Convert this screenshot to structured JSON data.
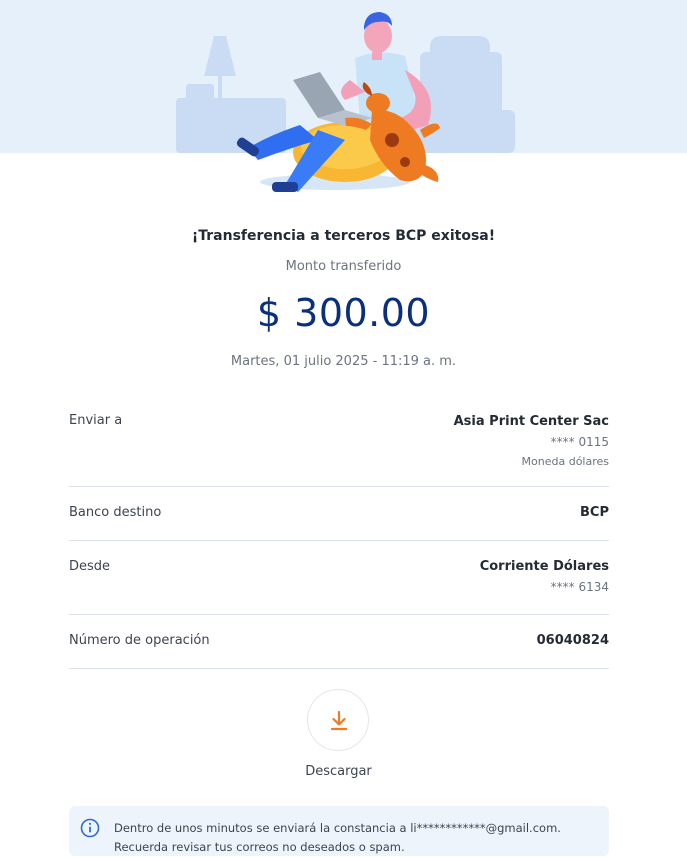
{
  "hero": {
    "illustration": "person-with-laptop-and-dog"
  },
  "colors": {
    "accent_orange": "#ee7a22",
    "primary_blue": "#0b2f7f",
    "hero_bg": "#e6f0fb"
  },
  "header": {
    "title": "¡Transferencia a terceros BCP exitosa!",
    "subtitle": "Monto transferido",
    "amount": "$ 300.00",
    "date": "Martes, 01 julio 2025 - 11:19 a. m."
  },
  "details": {
    "recipient": {
      "label": "Enviar a",
      "name": "Asia Print Center Sac",
      "account": "**** 0115",
      "currency": "Moneda dólares"
    },
    "bank": {
      "label": "Banco destino",
      "value": "BCP"
    },
    "origin": {
      "label": "Desde",
      "account_type": "Corriente Dólares",
      "account": "**** 6134"
    },
    "operation": {
      "label": "Número de operación",
      "value": "06040824"
    }
  },
  "download": {
    "icon": "download-icon",
    "label": "Descargar"
  },
  "notice": {
    "icon": "info-icon",
    "text": "Dentro de unos minutos se enviará la constancia a li************@gmail.com. Recuerda revisar tus correos no deseados o spam."
  }
}
